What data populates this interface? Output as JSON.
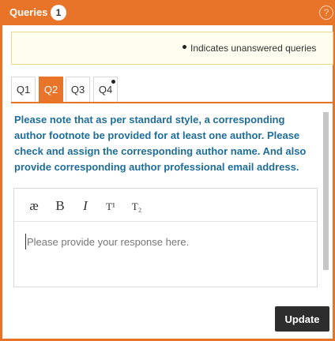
{
  "header": {
    "title": "Queries",
    "count": "1",
    "help_label": "?"
  },
  "legend": {
    "text": "Indicates unanswered queries"
  },
  "tabs": [
    {
      "label": "Q1",
      "active": false,
      "unanswered": false
    },
    {
      "label": "Q2",
      "active": true,
      "unanswered": false
    },
    {
      "label": "Q3",
      "active": false,
      "unanswered": false
    },
    {
      "label": "Q4",
      "active": false,
      "unanswered": true
    }
  ],
  "query": {
    "text": "Please note that as per standard style, a corresponding author footnote be provided for at least one author. Please check and assign the corresponding author name. And also provide corresponding author professional email address."
  },
  "editor": {
    "toolbar": {
      "special_char": "æ",
      "bold": "B",
      "italic": "I",
      "superscript": "T¹",
      "subscript": "T₂"
    },
    "placeholder": "Please provide your response here.",
    "value": ""
  },
  "actions": {
    "update_label": "Update"
  },
  "colors": {
    "accent": "#e8742a",
    "query_text": "#1f6d9a",
    "button": "#2d2d2d"
  }
}
